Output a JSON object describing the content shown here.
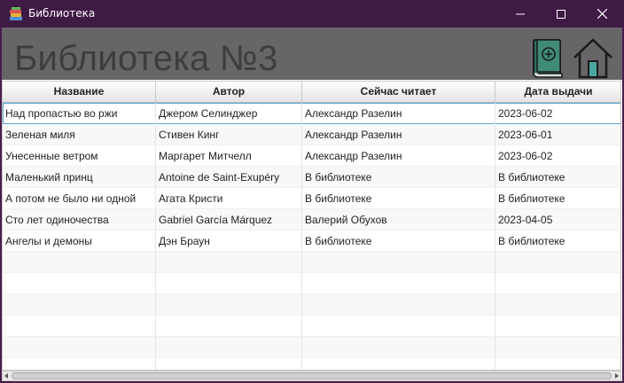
{
  "window": {
    "title": "Библиотека"
  },
  "header": {
    "title": "Библиотека №3"
  },
  "table": {
    "columns": [
      "Название",
      "Автор",
      "Сейчас читает",
      "Дата выдачи"
    ],
    "rows": [
      [
        "Над пропастью во ржи",
        "Джером Селинджер",
        "Александр Разелин",
        "2023-06-02"
      ],
      [
        "Зеленая миля",
        "Стивен Кинг",
        "Александр Разелин",
        "2023-06-01"
      ],
      [
        "Унесенные ветром",
        "Маргарет Митчелл",
        "Александр Разелин",
        "2023-06-02"
      ],
      [
        "Маленький принц",
        "Antoine de Saint-Exupéry",
        "В библиотеке",
        "В библиотеке"
      ],
      [
        "А потом не было ни одной",
        "Агата Кристи",
        "В библиотеке",
        "В библиотеке"
      ],
      [
        "Сто лет одиночества",
        "Gabriel García Márquez",
        "Валерий Обухов",
        "2023-04-05"
      ],
      [
        "Ангелы и демоны",
        "Дэн Браун",
        "В библиотеке",
        "В библиотеке"
      ]
    ],
    "empty_rows": 6,
    "selected_row": 0
  },
  "icons": {
    "app": "books-icon",
    "add_book": "add-book-icon",
    "home": "home-icon"
  },
  "colors": {
    "titlebar": "#3f1a45",
    "header": "#676567",
    "header_text": "#3e3c3e",
    "selection_border": "#5aa9d4"
  }
}
